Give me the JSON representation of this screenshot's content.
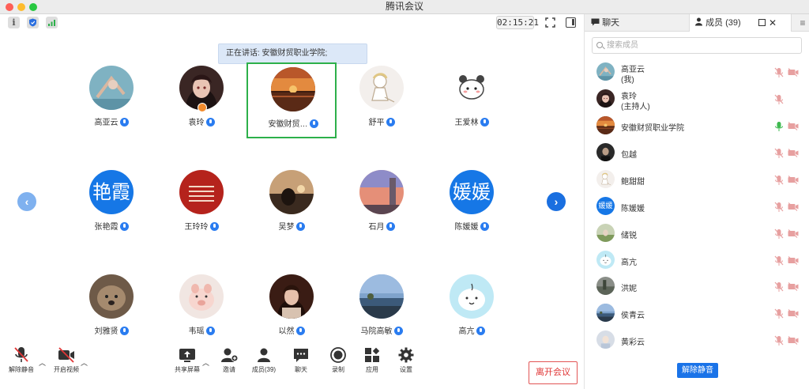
{
  "window": {
    "title": "腾讯会议"
  },
  "topbar": {
    "timer": "02:15:21"
  },
  "speaking": {
    "label": "正在讲话: 安徽财贸职业学院;"
  },
  "participants": [
    {
      "name": "高亚云",
      "avatar": "blue-photo"
    },
    {
      "name": "袁玲",
      "avatar": "girl-photo",
      "host": true
    },
    {
      "name": "安徽财贸…",
      "avatar": "sunset-photo",
      "active": true
    },
    {
      "name": "舒平",
      "avatar": "sketch-girl"
    },
    {
      "name": "王爱林",
      "avatar": "cartoon-bear"
    },
    {
      "name": "张艳霞",
      "avatar_text": "艳霞"
    },
    {
      "name": "王玲玲",
      "avatar": "red-text-photo"
    },
    {
      "name": "吴梦",
      "avatar": "dusk-photo"
    },
    {
      "name": "石月",
      "avatar": "sky-photo"
    },
    {
      "name": "陈媛媛",
      "avatar_text": "媛媛"
    },
    {
      "name": "刘雅贤",
      "avatar": "dog-photo"
    },
    {
      "name": "韦瑶",
      "avatar": "pig-toy"
    },
    {
      "name": "以然",
      "avatar": "woman-photo"
    },
    {
      "name": "马院高敏",
      "avatar": "lake-photo"
    },
    {
      "name": "高亢",
      "avatar": "cartoon-face"
    }
  ],
  "toolbar": {
    "unmute": "解除静音",
    "start_video": "开启视频",
    "share_screen": "共享屏幕",
    "invite": "邀请",
    "members": "成员(39)",
    "chat": "聊天",
    "record": "录制",
    "apps": "应用",
    "settings": "设置",
    "leave": "离开会议"
  },
  "panel": {
    "tab_chat": "聊天",
    "tab_members": "成员 (39)",
    "search_placeholder": "搜索成员",
    "unmute_all": "解除静音",
    "members": [
      {
        "name": "高亚云",
        "sub": "(我)",
        "avatar": "blue-photo"
      },
      {
        "name": "袁玲",
        "sub": "(主持人)",
        "avatar": "girl-photo"
      },
      {
        "name": "安徽财贸职业学院",
        "avatar": "sunset-photo",
        "speaking": true
      },
      {
        "name": "包越",
        "avatar": "dark-photo"
      },
      {
        "name": "鲍甜甜",
        "avatar": "sketch-girl"
      },
      {
        "name": "陈媛媛",
        "avatar_text": "媛媛"
      },
      {
        "name": "储锐",
        "avatar": "outdoor-photo"
      },
      {
        "name": "高亢",
        "avatar": "cartoon-face"
      },
      {
        "name": "洪妮",
        "avatar": "grey-photo"
      },
      {
        "name": "侯青云",
        "avatar": "lake-photo"
      },
      {
        "name": "黄彩云",
        "avatar": "light-photo"
      }
    ]
  },
  "colors": {
    "accent": "#1a73e8",
    "active_border": "#2db04a",
    "leave": "#e03535",
    "muted_icon": "#e7a0a0"
  }
}
